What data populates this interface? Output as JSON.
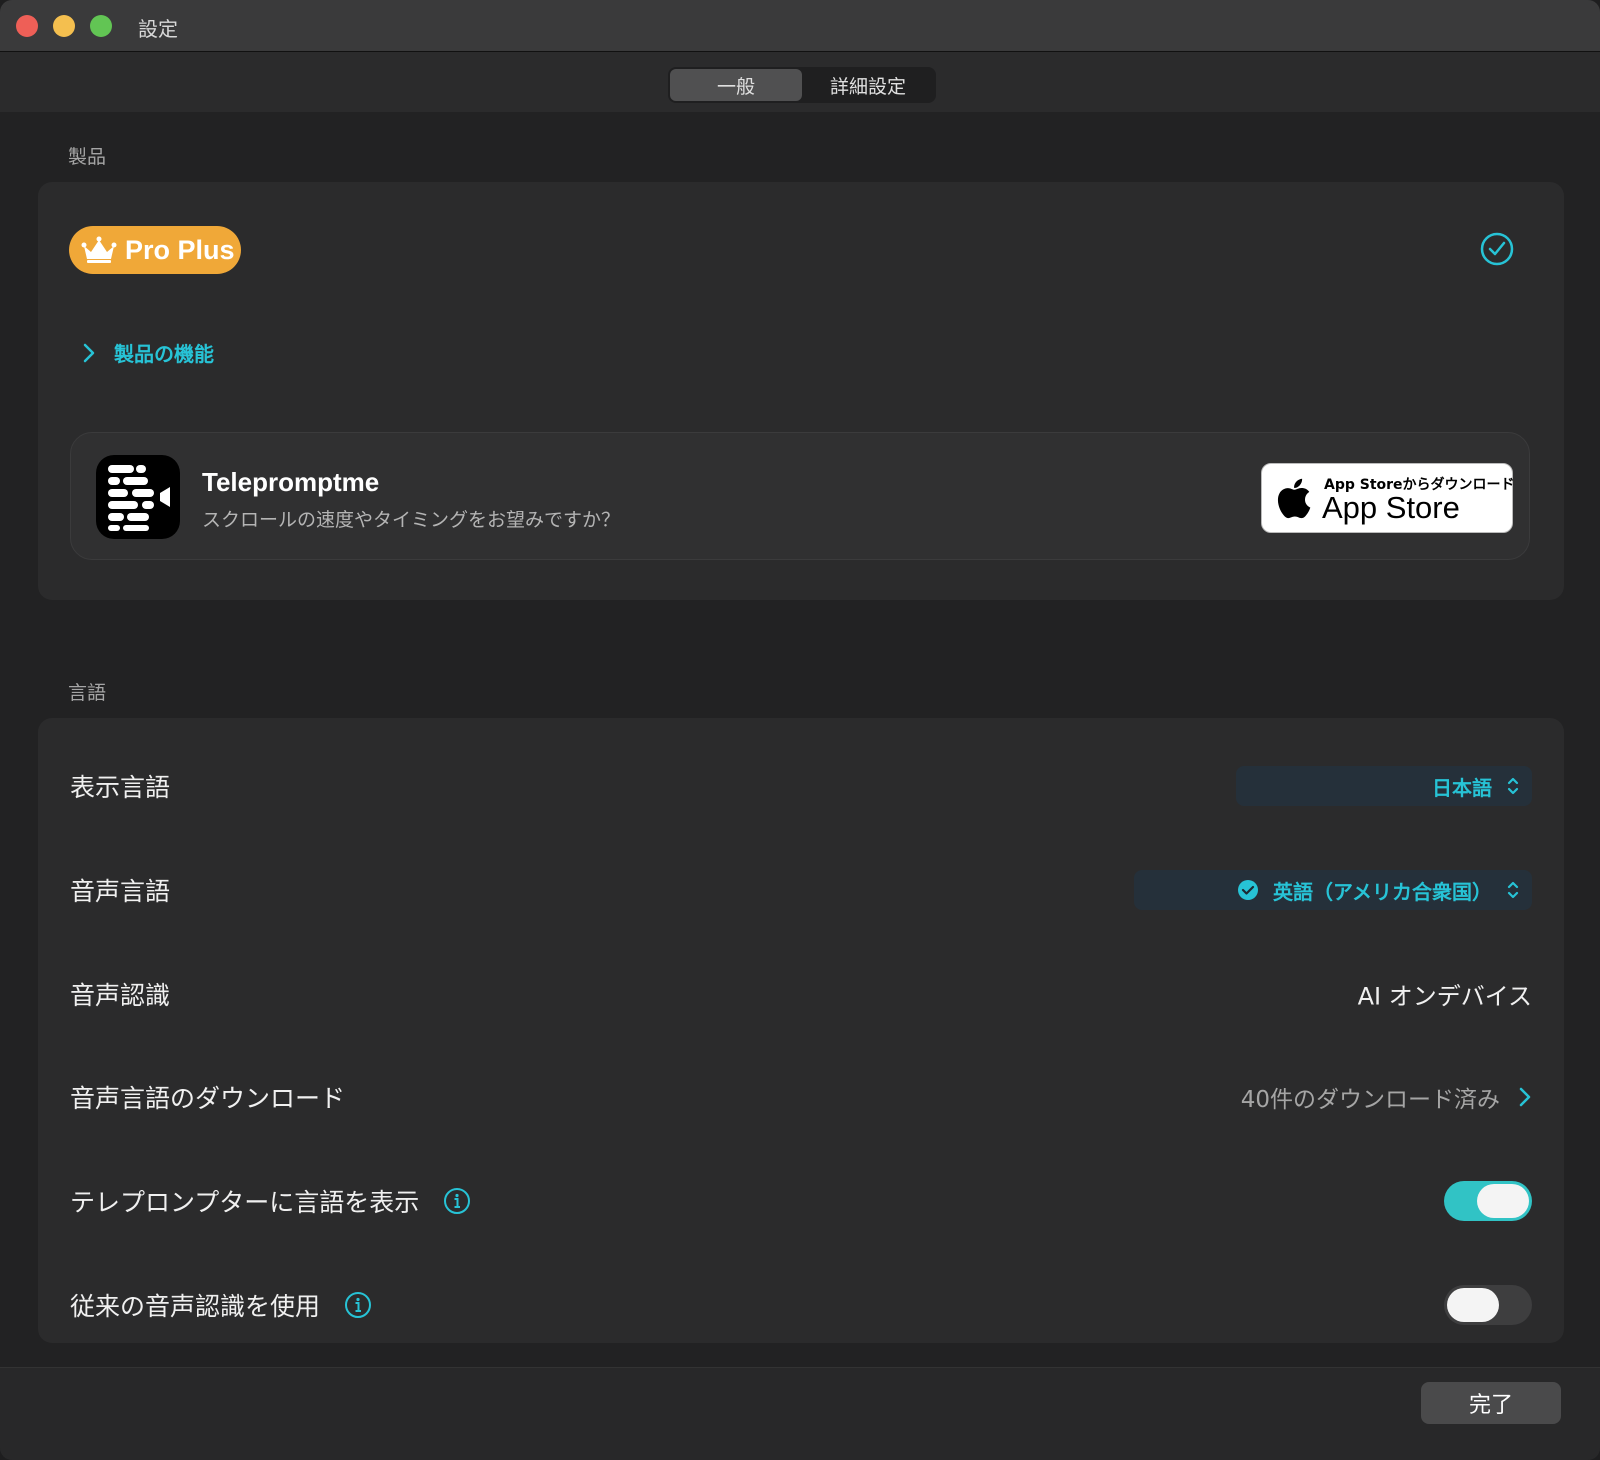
{
  "window": {
    "title": "設定"
  },
  "tabs": [
    {
      "label": "一般",
      "active": true
    },
    {
      "label": "詳細設定",
      "active": false
    }
  ],
  "product_section": {
    "title": "製品",
    "badge": {
      "label": "Pro Plus",
      "icon": "crown-icon",
      "color": "#f0a838"
    },
    "status_icon": "check-circle-icon",
    "features_link": "製品の機能",
    "promo": {
      "app_name": "Telepromptme",
      "description": "スクロールの速度やタイミングをお望みですか？",
      "store_small": "App Storeからダウンロード",
      "store_big": "App Store"
    }
  },
  "language_section": {
    "title": "言語",
    "rows": {
      "display_language": {
        "label": "表示言語",
        "value": "日本語"
      },
      "voice_language": {
        "label": "音声言語",
        "value": "英語（アメリカ合衆国）"
      },
      "speech_recognition": {
        "label": "音声認識",
        "value": "AI オンデバイス"
      },
      "download": {
        "label": "音声言語のダウンロード",
        "value": "40件のダウンロード済み"
      },
      "show_language": {
        "label": "テレプロンプターに言語を表示",
        "enabled": true
      },
      "legacy_recognition": {
        "label": "従来の音声認識を使用",
        "enabled": false
      }
    }
  },
  "footer": {
    "done_label": "完了"
  },
  "colors": {
    "accent": "#27c3d6",
    "toggle_on": "#31c3c5",
    "background": "#222223"
  }
}
